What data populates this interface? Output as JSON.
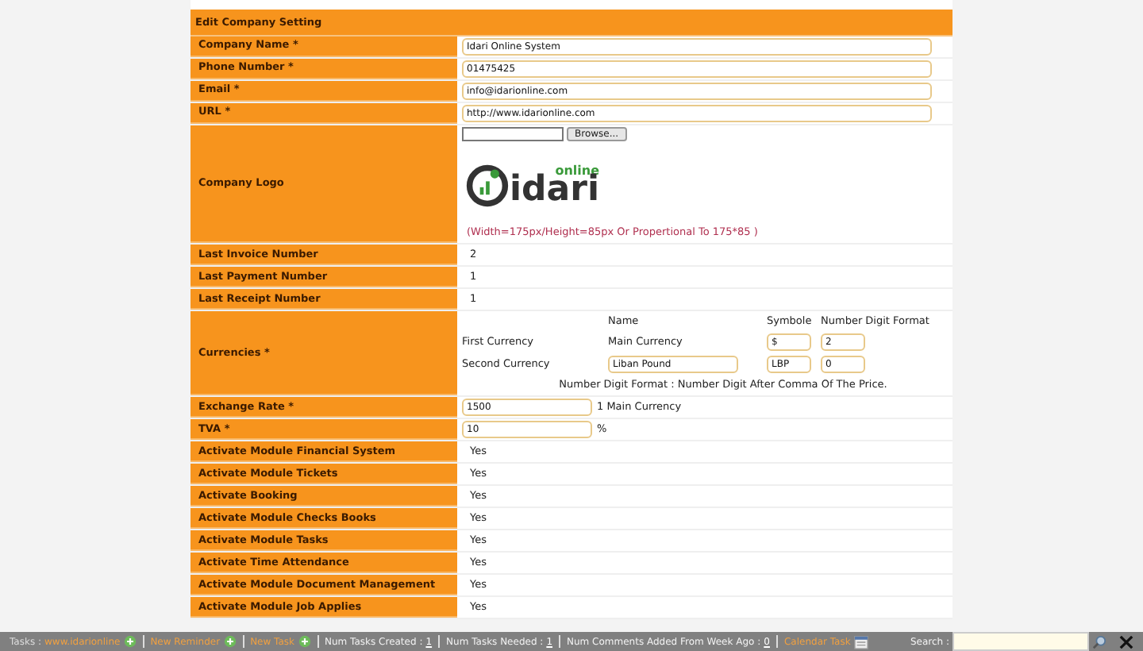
{
  "form": {
    "title": "Edit Company Setting",
    "rows": [
      {
        "kind": "input",
        "label": "Company Name *",
        "value": "Idari Online System"
      },
      {
        "kind": "input",
        "label": "Phone Number *",
        "value": "01475425"
      },
      {
        "kind": "input",
        "label": "Email *",
        "value": "info@idarionline.com"
      },
      {
        "kind": "input",
        "label": "URL *",
        "value": "http://www.idarionline.com"
      },
      {
        "kind": "logo",
        "label": "Company Logo",
        "button": "Browse...",
        "logo_word": "idari",
        "logo_tag": "online",
        "hint": "(Width=175px/Height=85px Or Propertional To 175*85 )"
      },
      {
        "kind": "text",
        "label": "Last Invoice Number",
        "value": "2"
      },
      {
        "kind": "text",
        "label": "Last Payment Number",
        "value": "1"
      },
      {
        "kind": "text",
        "label": "Last Receipt Number",
        "value": "1"
      },
      {
        "kind": "currencies",
        "label": "Currencies *",
        "headers": [
          "Name",
          "Symbole",
          "Number Digit Format"
        ],
        "currencies": [
          {
            "label": "First Currency",
            "kind": "text",
            "name": "Main Currency",
            "symbol": "$",
            "digits": "2"
          },
          {
            "label": "Second Currency",
            "kind": "input",
            "name": "Liban Pound",
            "symbol": "LBP",
            "digits": "0"
          }
        ],
        "note": "Number Digit Format : Number Digit After Comma Of The Price."
      },
      {
        "kind": "input_suffix",
        "label": "Exchange Rate *",
        "value": "1500",
        "suffix": "1 Main Currency"
      },
      {
        "kind": "input_suffix",
        "label": "TVA *",
        "value": "10",
        "suffix": "%"
      },
      {
        "kind": "text",
        "label": "Activate Module Financial System",
        "value": "Yes"
      },
      {
        "kind": "text",
        "label": "Activate Module Tickets",
        "value": "Yes"
      },
      {
        "kind": "text",
        "label": "Activate Booking",
        "value": "Yes"
      },
      {
        "kind": "text",
        "label": "Activate Module Checks Books",
        "value": "Yes"
      },
      {
        "kind": "text",
        "label": "Activate Module Tasks",
        "value": "Yes"
      },
      {
        "kind": "text",
        "label": "Activate Time Attendance",
        "value": "Yes"
      },
      {
        "kind": "text",
        "label": "Activate Module Document Management",
        "value": "Yes"
      },
      {
        "kind": "text",
        "label": "Activate Module Job Applies",
        "value": "Yes"
      }
    ]
  },
  "taskbar": {
    "items": [
      {
        "kind": "label",
        "text": "Tasks :"
      },
      {
        "kind": "add_link",
        "text": "www.idarionline"
      },
      {
        "kind": "add_link",
        "text": "New Reminder"
      },
      {
        "kind": "add_link",
        "text": "New Task"
      },
      {
        "kind": "stat",
        "text": "Num Tasks Created :",
        "value": "1"
      },
      {
        "kind": "stat",
        "text": "Num Tasks Needed :",
        "value": "1"
      },
      {
        "kind": "stat",
        "text": "Num Comments Added From Week Ago :",
        "value": "0"
      },
      {
        "kind": "calendar_link",
        "text": "Calendar Task"
      }
    ],
    "search_label": "Search :"
  }
}
